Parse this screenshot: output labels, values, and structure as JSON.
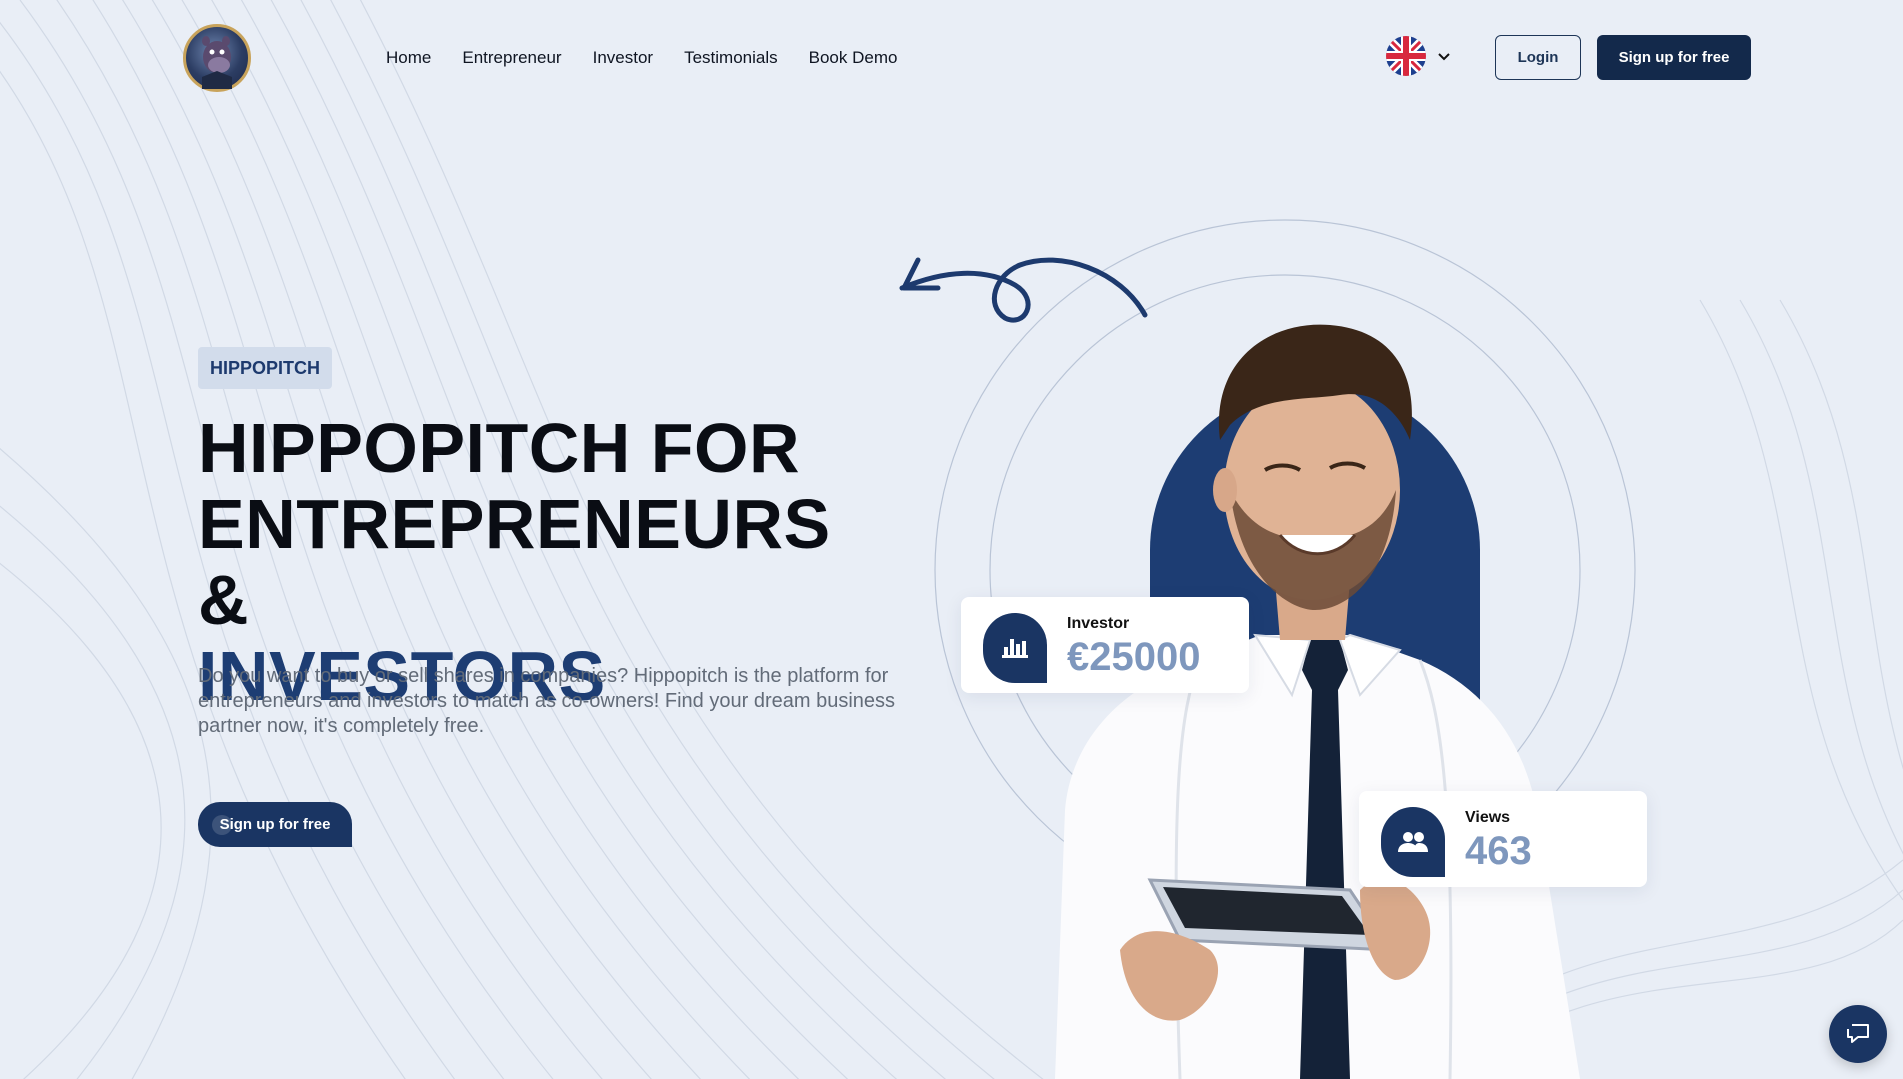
{
  "header": {
    "logo_name": "hippo-logo",
    "nav": [
      {
        "label": "Home"
      },
      {
        "label": "Entrepreneur"
      },
      {
        "label": "Investor"
      },
      {
        "label": "Testimonials"
      },
      {
        "label": "Book Demo"
      }
    ],
    "language_icon": "uk-flag-icon",
    "login_label": "Login",
    "signup_label": "Sign up for free"
  },
  "hero": {
    "badge": "HIPPOPITCH",
    "headline_line1": "HIPPOPITCH FOR",
    "headline_line2": "ENTREPRENEURS &",
    "headline_accent": "INVESTORS",
    "description": "Do you want to buy or sell shares in companies? Hippopitch is the platform for entrepreneurs and investors to match as co-owners! Find your dream business partner now, it's completely free.",
    "cta_label": "Sign up for free"
  },
  "stats": {
    "investor": {
      "label": "Investor",
      "value": "€25000",
      "icon": "bar-chart-icon"
    },
    "views": {
      "label": "Views",
      "value": "463",
      "icon": "users-icon"
    }
  },
  "colors": {
    "background": "#e9eef6",
    "brand_navy": "#13294b",
    "accent_blue": "#1d3d73",
    "stat_value": "#7e97bd"
  },
  "chat_icon": "chat-icon"
}
